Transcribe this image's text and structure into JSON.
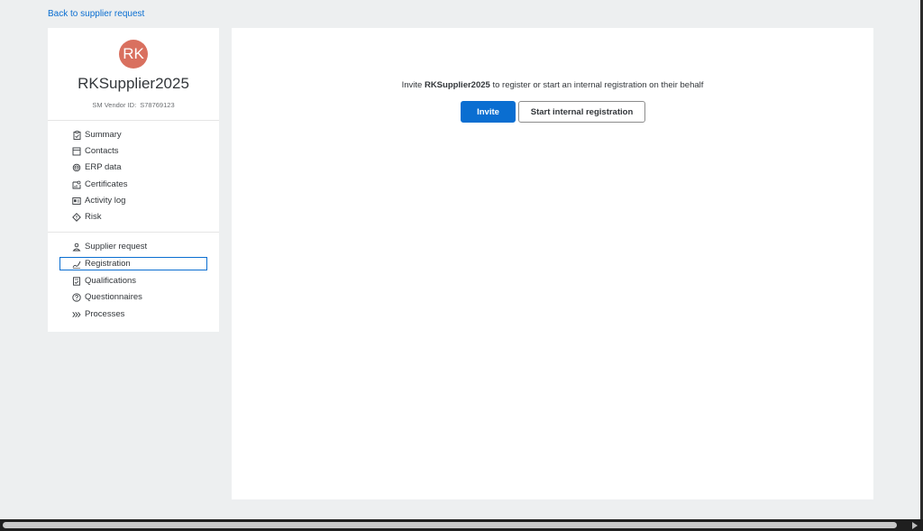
{
  "back_link": "Back to supplier request",
  "supplier": {
    "initials": "RK",
    "name": "RKSupplier2025",
    "vendor_id_label": "SM Vendor ID:",
    "vendor_id": "S78769123"
  },
  "nav_group1": [
    {
      "label": "Summary",
      "icon": "clipboard-icon"
    },
    {
      "label": "Contacts",
      "icon": "address-book-icon"
    },
    {
      "label": "ERP data",
      "icon": "database-sync-icon"
    },
    {
      "label": "Certificates",
      "icon": "certificate-icon"
    },
    {
      "label": "Activity log",
      "icon": "id-card-icon"
    },
    {
      "label": "Risk",
      "icon": "diamond-risk-icon"
    }
  ],
  "nav_group2": [
    {
      "label": "Supplier request",
      "icon": "person-request-icon"
    },
    {
      "label": "Registration",
      "icon": "signature-icon"
    },
    {
      "label": "Qualifications",
      "icon": "document-check-icon"
    },
    {
      "label": "Questionnaires",
      "icon": "question-circle-icon"
    },
    {
      "label": "Processes",
      "icon": "chevrons-right-icon"
    }
  ],
  "selected_nav": "Registration",
  "main": {
    "message_prefix": "Invite",
    "message_supplier": "RKSupplier2025",
    "message_suffix": "to register or start an internal registration on their behalf",
    "invite_button": "Invite",
    "internal_button": "Start internal registration"
  },
  "colors": {
    "accent": "#0a6ed1",
    "avatar": "#d9705f",
    "background": "#edeff0"
  }
}
